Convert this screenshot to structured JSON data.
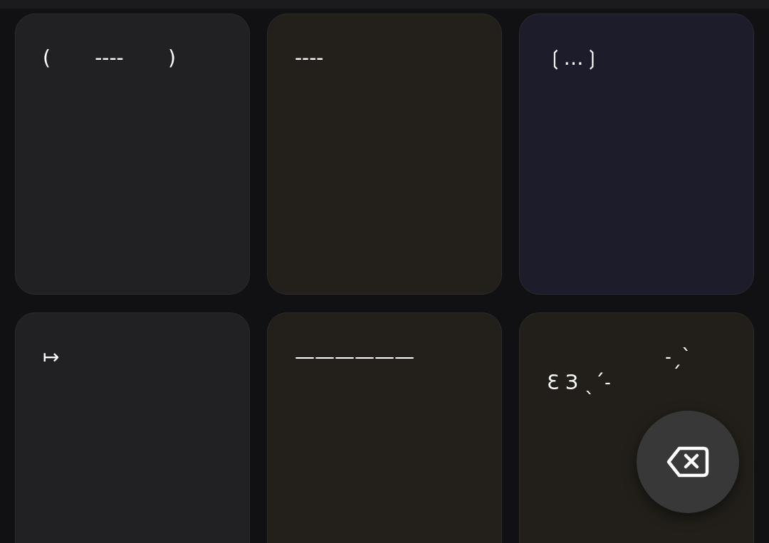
{
  "cards": [
    {
      "lines": [
        "(       ----       )"
      ],
      "color": "#212123"
    },
    {
      "lines": [
        "----"
      ],
      "color": "#23201b"
    },
    {
      "lines": [
        "❲…❳"
      ],
      "color": "#1d1c2b"
    },
    {
      "lines": [
        "↦"
      ],
      "color": "#212123"
    },
    {
      "lines": [
        "——————"
      ],
      "color": "#23201b"
    },
    {
      "lines": [
        "˗ˏˋ",
        "Ɛ З ˎˊ˗"
      ],
      "color": "#221f1a"
    }
  ]
}
